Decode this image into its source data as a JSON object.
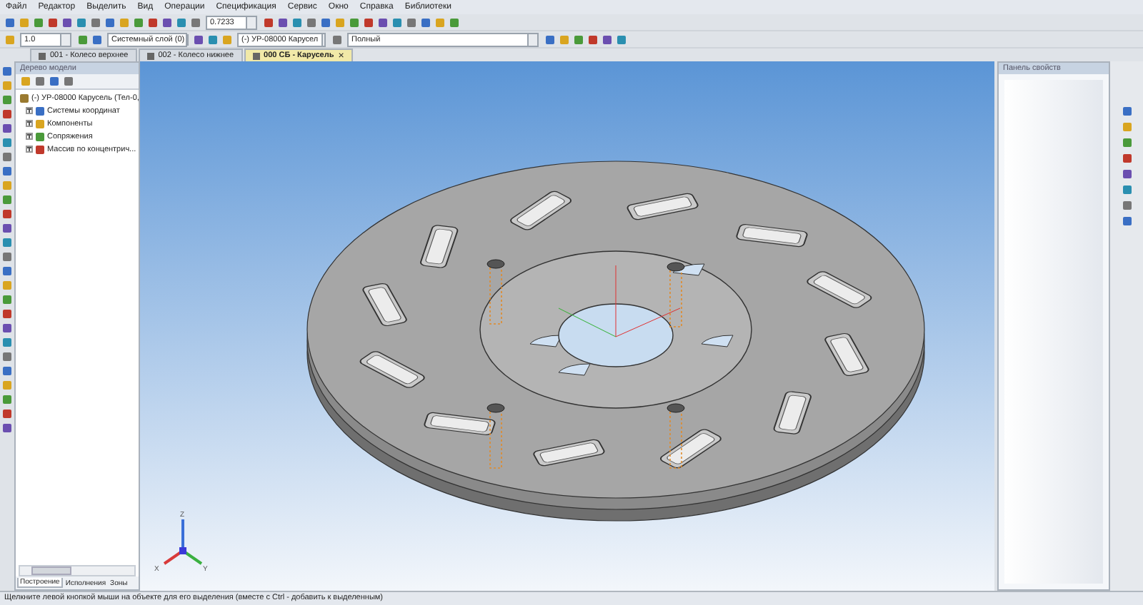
{
  "menu": [
    "Файл",
    "Редактор",
    "Выделить",
    "Вид",
    "Операции",
    "Спецификация",
    "Сервис",
    "Окно",
    "Справка",
    "Библиотеки"
  ],
  "toolbar": {
    "zoom": "0.7233",
    "scale": "1.0",
    "layer": "Системный слой (0)",
    "component": "(-) УР-08000 Карусел",
    "view_mode": "Полный"
  },
  "tabs": [
    {
      "label": "001 - Колесо верхнее",
      "selected": false
    },
    {
      "label": "002 - Колесо нижнее",
      "selected": false
    },
    {
      "label": "000 СБ - Карусель",
      "selected": true
    }
  ],
  "tab_close": "×",
  "tree_panel": {
    "title": "Дерево модели",
    "root": {
      "label": "(-) УР-08000 Карусель (Тел-0,",
      "children": [
        {
          "label": "Системы координат",
          "expanded": false
        },
        {
          "label": "Компоненты",
          "expanded": false
        },
        {
          "label": "Сопряжения",
          "expanded": false
        },
        {
          "label": "Массив по концентрич...",
          "expanded": false
        }
      ]
    },
    "bottom_tabs": [
      {
        "label": "Построение",
        "selected": true
      },
      {
        "label": "Исполнения",
        "selected": false
      },
      {
        "label": "Зоны",
        "selected": false
      }
    ]
  },
  "axes": {
    "x": "X",
    "y": "Y",
    "z": "Z"
  },
  "properties_panel": {
    "title": "Панель свойств"
  },
  "status_bar": "Щелкните левой кнопкой мыши на объекте для его выделения (вместе с Ctrl - добавить к выделенным)"
}
